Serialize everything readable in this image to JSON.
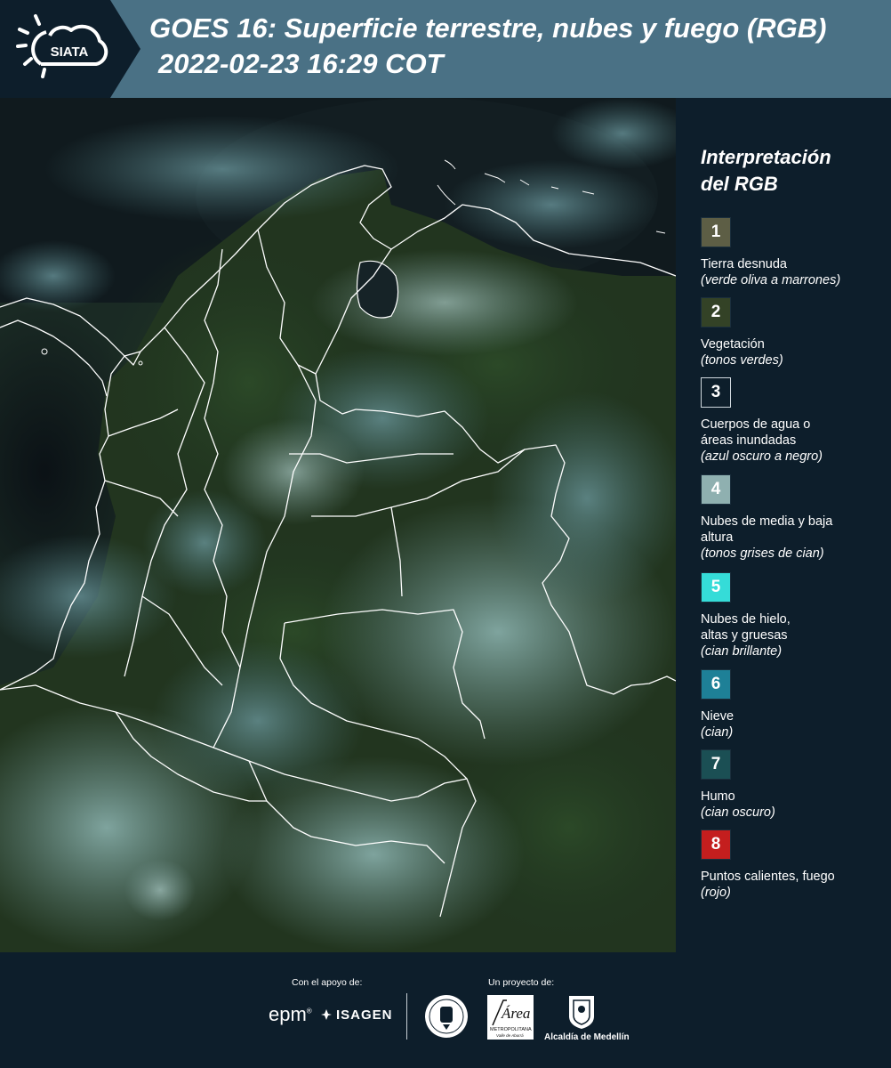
{
  "header": {
    "logo_text": "SIATA",
    "title_line1": "GOES 16: Superficie terrestre, nubes y fuego (RGB)",
    "title_line2": "2022-02-23 16:29 COT",
    "bg_color": "#4a7185",
    "logo_bg_color": "#0d1e2b"
  },
  "legend": {
    "title_line1": "Interpretación",
    "title_line2": "del RGB",
    "items": [
      {
        "number": "1",
        "name": "Tierra desnuda",
        "desc": "(verde oliva a marrones)",
        "color": "#5d5e45"
      },
      {
        "number": "2",
        "name": "Vegetación",
        "desc": "(tonos verdes)",
        "color": "#334226"
      },
      {
        "number": "3",
        "name": "Cuerpos de agua o áreas inundadas",
        "desc": "(azul oscuro a negro)",
        "color": "#0d1e2b"
      },
      {
        "number": "4",
        "name": "Nubes de media y baja altura",
        "desc": "(tonos grises de cian)",
        "color": "#8fb0b0"
      },
      {
        "number": "5",
        "name": "Nubes de hielo, altas y gruesas",
        "desc": "(cian brillante)",
        "color": "#35dcd8"
      },
      {
        "number": "6",
        "name": "Nieve",
        "desc": "(cian)",
        "color": "#1e8097"
      },
      {
        "number": "7",
        "name": "Humo",
        "desc": "(cian oscuro)",
        "color": "#1b4f54"
      },
      {
        "number": "8",
        "name": "Puntos calientes, fuego",
        "desc": "(rojo)",
        "color": "#c41e1e"
      }
    ]
  },
  "footer": {
    "support_label": "Con el apoyo de:",
    "project_label": "Un proyecto de:",
    "sponsor_epm": "epm",
    "sponsor_isagen": "ISAGEN",
    "area_text": "Área",
    "area_subtext": "METROPOLITANA",
    "area_subtext2": "Valle de Aburrá",
    "alcaldia": "Alcaldía de Medellín"
  }
}
